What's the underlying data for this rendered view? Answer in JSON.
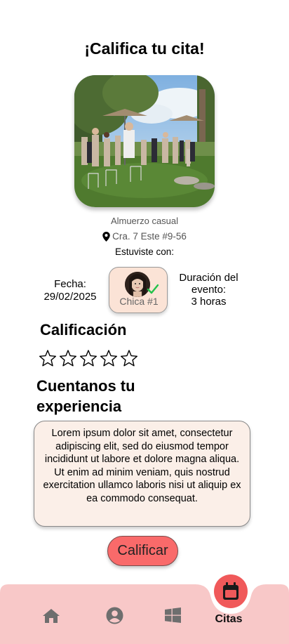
{
  "page": {
    "title": "¡Califica tu cita!"
  },
  "event": {
    "name": "Almuerzo casual",
    "location": "Cra. 7 Este #9-56",
    "with_label": "Estuviste con:"
  },
  "details": {
    "date_label": "Fecha:",
    "date_value": "29/02/2025",
    "partner_label": "Chica #1",
    "duration_label_line1": "Duración del",
    "duration_label_line2": "evento:",
    "duration_value": "3 horas"
  },
  "rating": {
    "title": "Calificación",
    "value": 0,
    "max": 5
  },
  "experience": {
    "title": "Cuentanos tu experiencia",
    "text": "Lorem ipsum dolor sit amet, consectetur adipiscing elit, sed do eiusmod tempor incididunt ut labore et dolore magna aliqua. Ut enim ad minim veniam, quis nostrud exercitation ullamco laboris nisi ut aliquip ex ea commodo consequat."
  },
  "actions": {
    "submit_label": "Calificar"
  },
  "nav": {
    "active_label": "Citas",
    "items": [
      "home-icon",
      "profile-icon",
      "windows-icon",
      "calendar-icon"
    ]
  },
  "colors": {
    "accent": "#f96a6a",
    "nav_bg": "#f8c8c8",
    "nav_active": "#f0595a",
    "card_bg": "#fbe3d6",
    "review_bg": "#fbefe8"
  }
}
